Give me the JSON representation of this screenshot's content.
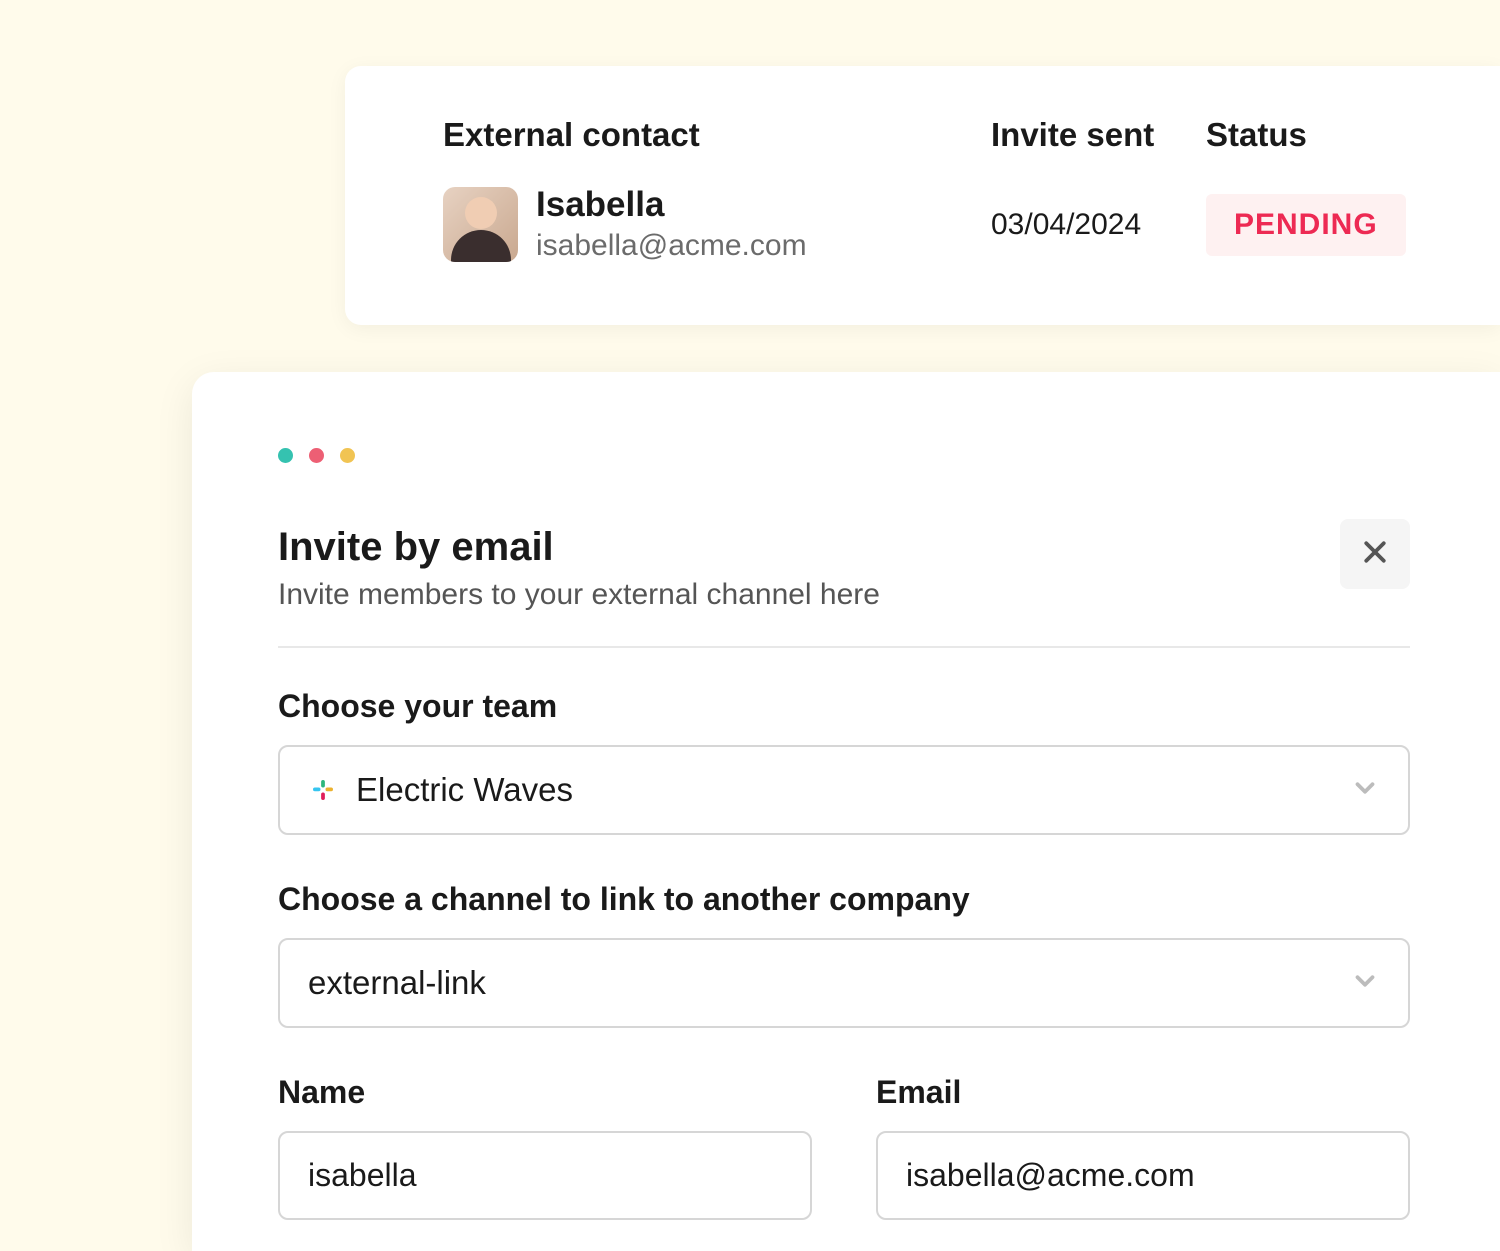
{
  "contact_card": {
    "headers": {
      "contact": "External contact",
      "invite_sent": "Invite sent",
      "status": "Status"
    },
    "row": {
      "name": "Isabella",
      "email": "isabella@acme.com",
      "invite_sent": "03/04/2024",
      "status": "PENDING"
    }
  },
  "modal": {
    "title": "Invite by email",
    "subtitle": "Invite members to your external channel here",
    "team_label": "Choose your team",
    "team_value": "Electric Waves",
    "channel_label": "Choose a channel to link to another company",
    "channel_value": "external-link",
    "name_label": "Name",
    "name_value": "isabella",
    "email_label": "Email",
    "email_value": "isabella@acme.com"
  },
  "colors": {
    "accent_red": "#ed2a53",
    "badge_bg": "#fef1f1"
  }
}
